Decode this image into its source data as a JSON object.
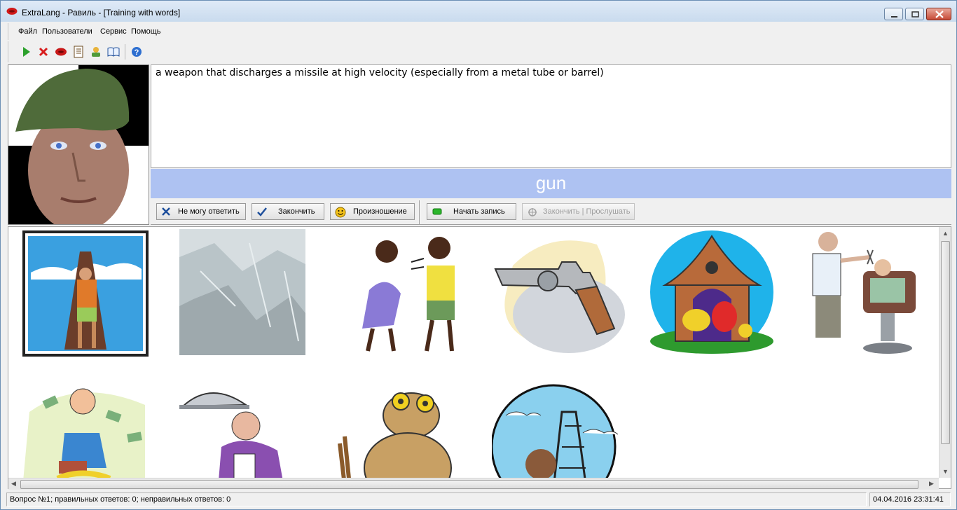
{
  "window": {
    "title": "ExtraLang - Равиль - [Training with words]"
  },
  "menu": {
    "items": [
      "Файл",
      "Пользователи",
      "Сервис",
      "Помощь"
    ]
  },
  "toolbar": {
    "icons": [
      "play-icon",
      "stop-icon",
      "heart-icon",
      "notebook-icon",
      "user-icon",
      "book-icon",
      "help-icon"
    ]
  },
  "definition": {
    "text": "a weapon that discharges a missile at high velocity (especially from a metal tube or barrel)"
  },
  "answer": {
    "word": "gun"
  },
  "actions": {
    "cant_answer": "Не могу ответить",
    "finish": "Закончить",
    "pronunciation": "Произношение",
    "start_record": "Начать запись",
    "finish_listen": "Закончить | Прослушать"
  },
  "pictures": [
    "tourist-eiffel-tower",
    "ice-texture",
    "arguing-couple",
    "revolver-gun",
    "bird-house",
    "barber",
    "girl-money",
    "waiter-tray",
    "toad",
    "oil-rig-man"
  ],
  "status": {
    "left": "Вопрос №1; правильных ответов: 0; неправильных ответов: 0",
    "right": "04.04.2016 23:31:41"
  },
  "colors": {
    "answer_bar": "#aec2f2",
    "titlebar": "#c9dbee"
  }
}
